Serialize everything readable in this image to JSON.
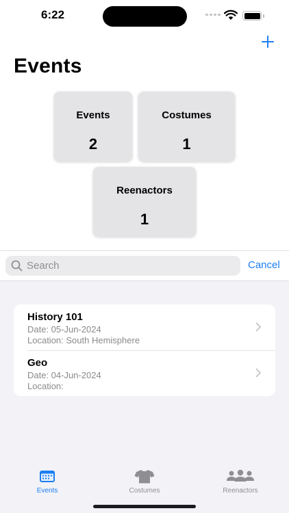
{
  "status_bar": {
    "time": "6:22"
  },
  "header": {
    "title": "Events",
    "add_icon": "plus-icon"
  },
  "stats": [
    {
      "label": "Events",
      "value": "2"
    },
    {
      "label": "Costumes",
      "value": "1"
    },
    {
      "label": "Reenactors",
      "value": "1"
    }
  ],
  "search": {
    "placeholder": "Search",
    "value": "",
    "cancel_label": "Cancel"
  },
  "events": [
    {
      "title": "History 101",
      "date": "Date: 05-Jun-2024",
      "location": "Location: South Hemisphere"
    },
    {
      "title": "Geo",
      "date": "Date: 04-Jun-2024",
      "location": "Location:"
    }
  ],
  "tabs": [
    {
      "label": "Events",
      "icon": "calendar-icon",
      "active": true
    },
    {
      "label": "Costumes",
      "icon": "tshirt-icon",
      "active": false
    },
    {
      "label": "Reenactors",
      "icon": "people-icon",
      "active": false
    }
  ],
  "colors": {
    "accent": "#1a7ef3",
    "inactive": "#8e8e93",
    "card": "#e4e4e6",
    "list_bg": "#f2f2f7"
  }
}
